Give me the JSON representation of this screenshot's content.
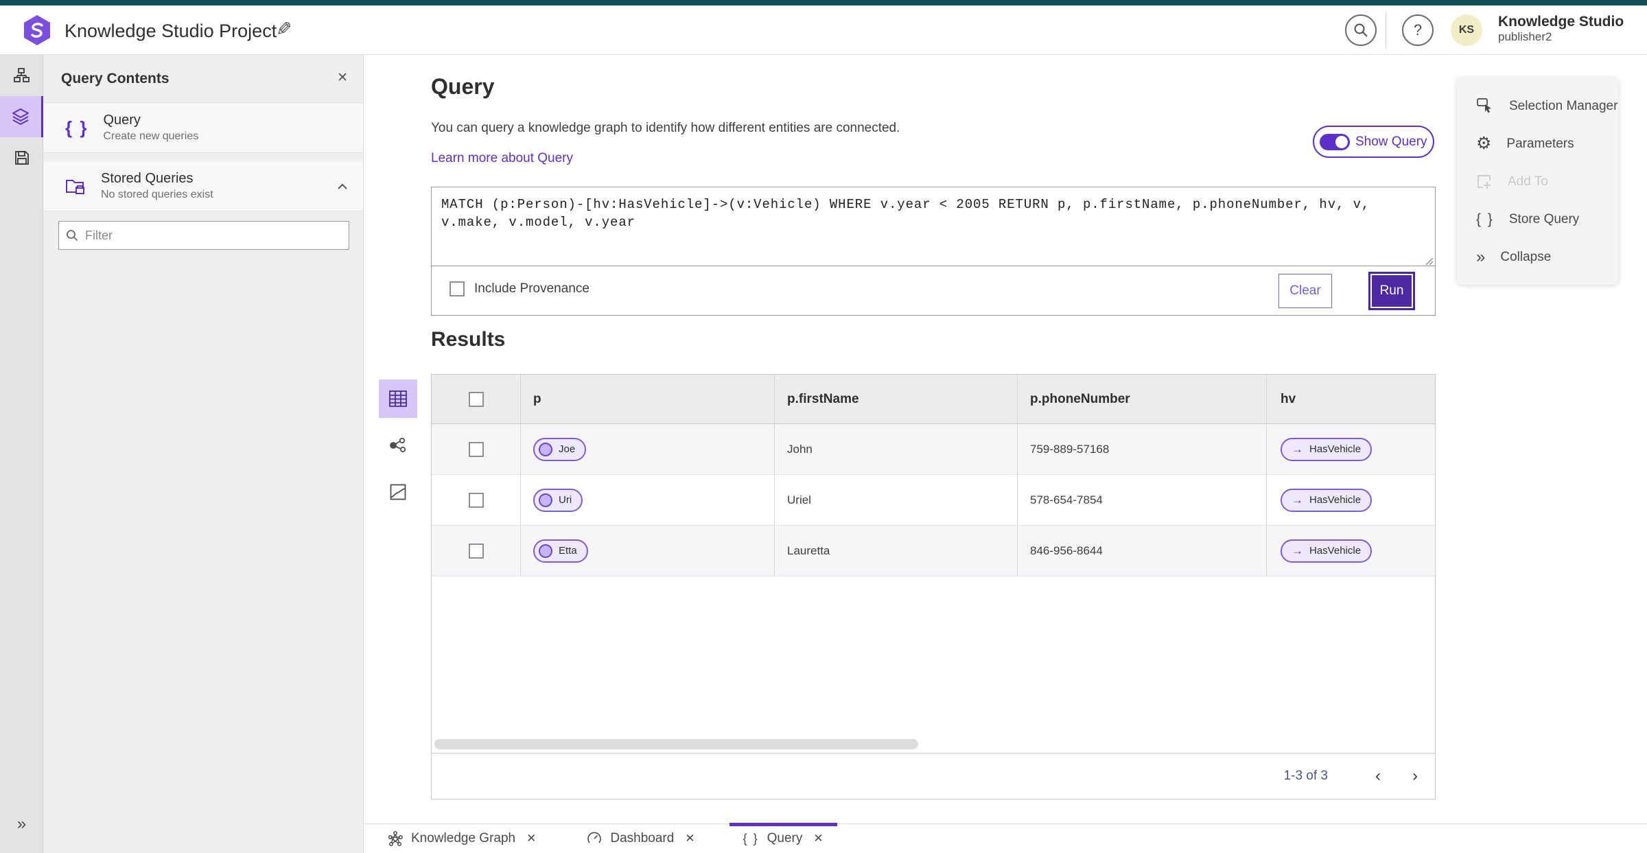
{
  "icons": {
    "close": "✕",
    "collapse_double": "»",
    "braces": "{ }",
    "arrow_right": "→",
    "prev": "‹",
    "next": "›",
    "help": "?",
    "gear": "⚙",
    "pencil": "✎"
  },
  "header": {
    "title": "Knowledge Studio Project",
    "user_initials": "KS",
    "user_line1": "Knowledge Studio",
    "user_line2": "publisher2"
  },
  "contents_panel": {
    "title": "Query Contents",
    "query_item": {
      "label": "Query",
      "description": "Create new queries"
    },
    "stored_item": {
      "label": "Stored Queries",
      "description": "No stored queries exist"
    },
    "filter_placeholder": "Filter"
  },
  "query": {
    "heading": "Query",
    "description": "You can query a knowledge graph to identify how different entities are connected.",
    "link": "Learn more about Query",
    "show_query_label": "Show Query",
    "text": "MATCH (p:Person)-[hv:HasVehicle]->(v:Vehicle) WHERE v.year < 2005 RETURN p, p.firstName, p.phoneNumber, hv, v, v.make, v.model, v.year",
    "include_provenance_label": "Include Provenance",
    "clear_label": "Clear",
    "run_label": "Run"
  },
  "results": {
    "heading": "Results",
    "columns": [
      "p",
      "p.firstName",
      "p.phoneNumber",
      "hv"
    ],
    "rows": [
      {
        "p": "Joe",
        "firstName": "John",
        "phoneNumber": "759-889-57168",
        "hv": "HasVehicle"
      },
      {
        "p": "Uri",
        "firstName": "Uriel",
        "phoneNumber": "578-654-7854",
        "hv": "HasVehicle"
      },
      {
        "p": "Etta",
        "firstName": "Lauretta",
        "phoneNumber": "846-956-8644",
        "hv": "HasVehicle"
      }
    ],
    "pagination": "1-3 of 3"
  },
  "side_menu": {
    "selection_manager": "Selection Manager",
    "parameters": "Parameters",
    "add_to": "Add To",
    "store_query": "Store Query",
    "collapse": "Collapse"
  },
  "tabs": {
    "knowledge_graph": "Knowledge Graph",
    "dashboard": "Dashboard",
    "query": "Query"
  },
  "colors": {
    "accent": "#5E2FC9",
    "accent_dark": "#4D28A3",
    "teal": "#0E4E57"
  }
}
